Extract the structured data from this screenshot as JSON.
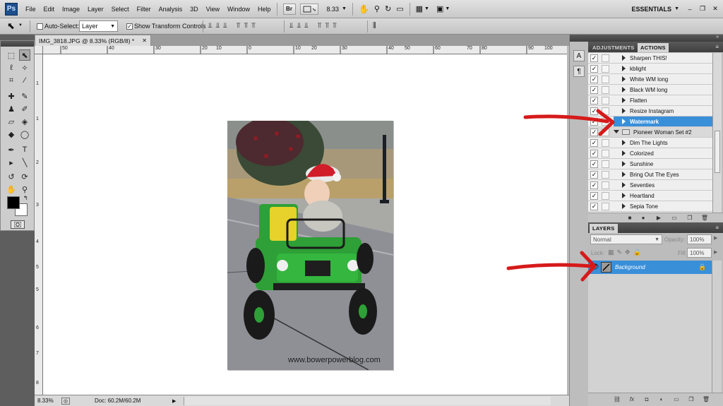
{
  "app": {
    "logo": "Ps",
    "workspace": "ESSENTIALS",
    "zoom_dropdown": "8.33"
  },
  "menu": [
    "File",
    "Edit",
    "Image",
    "Layer",
    "Select",
    "Filter",
    "Analysis",
    "3D",
    "View",
    "Window",
    "Help"
  ],
  "menubar_buttons": {
    "bridge": "Br"
  },
  "options_bar": {
    "auto_select_label": "Auto-Select:",
    "auto_select_checked": false,
    "auto_select_target": "Layer",
    "show_transform_label": "Show Transform Controls",
    "show_transform_checked": true
  },
  "document": {
    "tab_title": "IMG_3818.JPG @ 8.33% (RGB/8) *",
    "ruler_top_labels": [
      "50",
      "40",
      "30",
      "20",
      "10",
      "0",
      "10",
      "20",
      "30",
      "40",
      "50",
      "60",
      "70",
      "80",
      "90",
      "100"
    ],
    "ruler_left_labels": [
      "1",
      "1",
      "2",
      "3",
      "4",
      "5",
      "5",
      "6",
      "7",
      "8"
    ],
    "zoom": "8.33%",
    "doc_size": "Doc: 60.2M/60.2M",
    "photo": {
      "watermark_text": "www.bowerpowerblog.com"
    }
  },
  "adjustments_tab": "ADJUSTMENTS",
  "actions_tab": "ACTIONS",
  "actions": [
    {
      "label": "Sharpen THIS!",
      "checked": true,
      "type": "action",
      "selected": false
    },
    {
      "label": "kblight",
      "checked": true,
      "type": "action",
      "selected": false
    },
    {
      "label": "White WM long",
      "checked": true,
      "type": "action",
      "selected": false
    },
    {
      "label": "Black WM long",
      "checked": true,
      "type": "action",
      "selected": false
    },
    {
      "label": "Flatten",
      "checked": true,
      "type": "action",
      "selected": false
    },
    {
      "label": "Resize Instagram",
      "checked": true,
      "type": "action",
      "selected": false
    },
    {
      "label": "Watermark",
      "checked": true,
      "type": "action",
      "selected": true
    },
    {
      "label": "Pioneer Woman Set #2",
      "checked": true,
      "type": "set",
      "selected": false
    },
    {
      "label": "Dim The Lights",
      "checked": true,
      "type": "action",
      "selected": false
    },
    {
      "label": "Colorized",
      "checked": true,
      "type": "action",
      "selected": false
    },
    {
      "label": "Sunshine",
      "checked": true,
      "type": "action",
      "selected": false
    },
    {
      "label": "Bring Out The Eyes",
      "checked": true,
      "type": "action",
      "selected": false
    },
    {
      "label": "Seventies",
      "checked": true,
      "type": "action",
      "selected": false
    },
    {
      "label": "Heartland",
      "checked": true,
      "type": "action",
      "selected": false
    },
    {
      "label": "Sepia Tone",
      "checked": true,
      "type": "action",
      "selected": false
    }
  ],
  "layers": {
    "tab": "LAYERS",
    "blend_mode": "Normal",
    "opacity_label": "Opacity:",
    "opacity_value": "100%",
    "lock_label": "Lock:",
    "fill_label": "Fill:",
    "fill_value": "100%",
    "items": [
      {
        "name": "Background",
        "visible": true,
        "locked": true
      }
    ]
  },
  "colors": {
    "accent_blue": "#3a8fd9",
    "arrow_red": "#d61a1a",
    "panel_dark": "#4a4a4a"
  }
}
